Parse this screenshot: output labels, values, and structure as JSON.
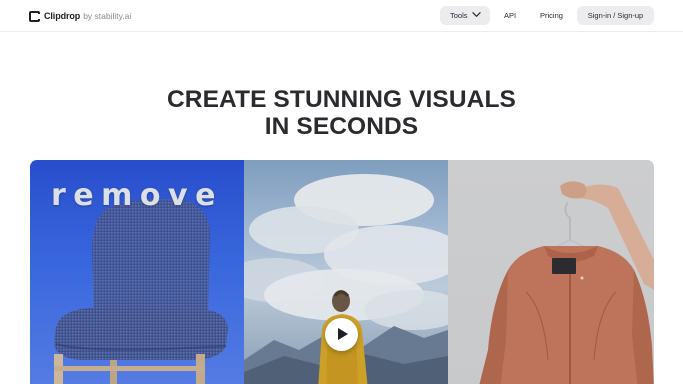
{
  "header": {
    "logo": {
      "name": "Clipdrop",
      "byline": "by stability.ai"
    },
    "nav": {
      "tools_label": "Tools",
      "api_label": "API",
      "pricing_label": "Pricing",
      "signin_label": "Sign-in / Sign-up"
    }
  },
  "hero": {
    "title_line1": "CREATE STUNNING VISUALS",
    "title_line2": "IN SECONDS"
  },
  "media": {
    "panel1_overlay_text": "remove",
    "play_icon": "play-icon"
  },
  "colors": {
    "accent_blue": "#2b52d8",
    "nav_pill": "#ececef",
    "title": "#2b2b2f"
  }
}
